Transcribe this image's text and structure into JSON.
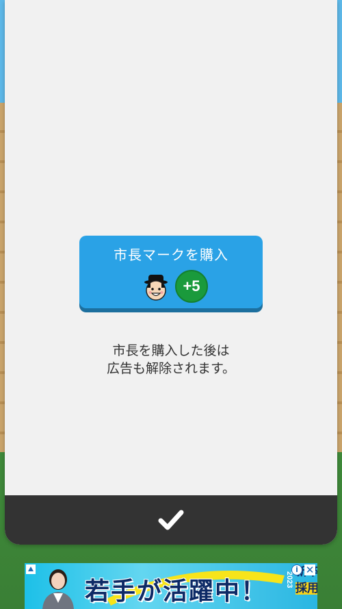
{
  "colors": {
    "modal_bg": "#f1f1f1",
    "button_bg": "#2aa2e6",
    "badge_bg": "#1a9a3c",
    "confirm_bar_bg": "#333333",
    "text": "#333333"
  },
  "purchase": {
    "button_label": "市長マークを購入",
    "icon": "mayor-face-icon",
    "bonus": "+5"
  },
  "description": {
    "line1": "市長を購入した後は",
    "line2": "広告も解除されます。"
  },
  "confirm": {
    "icon": "checkmark-icon"
  },
  "ad": {
    "headline": "若手が活躍中！",
    "year": "2023",
    "tag_line1": "新卒",
    "tag_line2": "採用",
    "info_label": "i",
    "close_label": "✕"
  }
}
